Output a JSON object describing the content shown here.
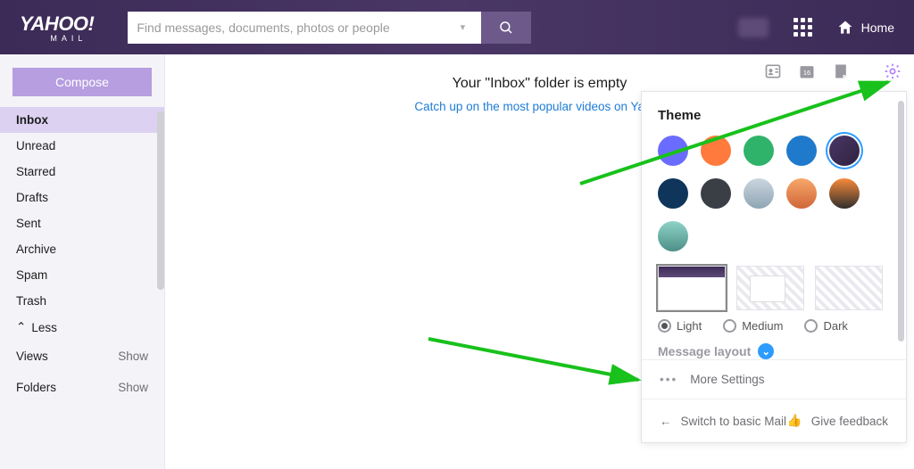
{
  "header": {
    "logo_main": "YAHOO",
    "logo_bang": "!",
    "logo_sub": "MAIL",
    "search_placeholder": "Find messages, documents, photos or people",
    "home_label": "Home"
  },
  "sidebar": {
    "compose": "Compose",
    "folders": [
      "Inbox",
      "Unread",
      "Starred",
      "Drafts",
      "Sent",
      "Archive",
      "Spam",
      "Trash"
    ],
    "less": "Less",
    "views_label": "Views",
    "views_action": "Show",
    "folders_label": "Folders",
    "folders_action": "Show"
  },
  "main": {
    "empty_title": "Your \"Inbox\" folder is empty",
    "empty_link": "Catch up on the most popular videos on Yahoo"
  },
  "rail": {
    "calendar_day": "16"
  },
  "panel": {
    "theme_title": "Theme",
    "swatch_colors": [
      "#6a6cff",
      "#ff7a3c",
      "#2fb36b",
      "#1f7acb",
      "linear-gradient(135deg,#4a3766,#2f2240)",
      "#0f355a",
      "#3a3f46",
      "linear-gradient(#cbd6df,#8ea5b4)",
      "linear-gradient(#f7a86a,#d06638)",
      "linear-gradient(#f98a3a,#2f2e2e)",
      "linear-gradient(#8fd3c7,#4c8f87)"
    ],
    "swatch_selected_index": 4,
    "modes": [
      "Light",
      "Medium",
      "Dark"
    ],
    "mode_selected": "Light",
    "message_layout": "Message layout",
    "more": "More Settings",
    "switch": "Switch to basic Mail",
    "feedback": "Give feedback"
  }
}
